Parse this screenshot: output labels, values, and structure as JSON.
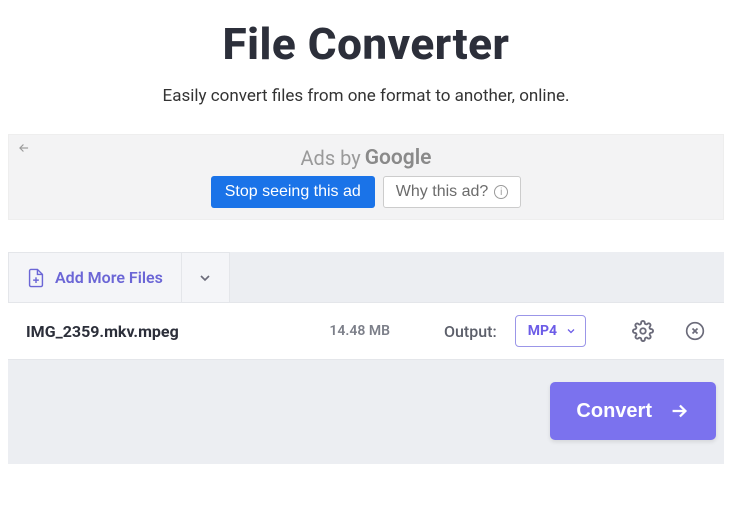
{
  "header": {
    "title": "File Converter",
    "subtitle": "Easily convert files from one format to another, online."
  },
  "ad": {
    "label_prefix": "Ads by",
    "label_brand": "Google",
    "stop_label": "Stop seeing this ad",
    "why_label": "Why this ad?"
  },
  "toolbar": {
    "add_more_label": "Add More Files"
  },
  "file": {
    "name": "IMG_2359.mkv.mpeg",
    "size": "14.48 MB",
    "output_label": "Output:",
    "output_value": "MP4"
  },
  "actions": {
    "convert_label": "Convert"
  }
}
